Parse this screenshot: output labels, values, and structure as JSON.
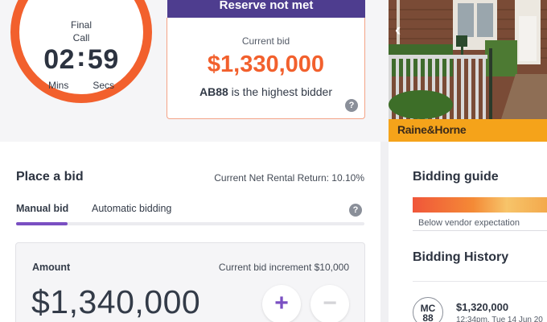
{
  "timer": {
    "label_line1": "Final",
    "label_line2": "Call",
    "minutes": "02",
    "separator": ":",
    "seconds": "59",
    "minutes_unit": "Mins",
    "seconds_unit": "Secs",
    "ring_color": "#f2602d"
  },
  "reserve": {
    "banner": "Reserve not met",
    "banner_color": "#4e3d8f"
  },
  "current_bid": {
    "label": "Current bid",
    "amount": "$1,330,000",
    "amount_color": "#f2602d",
    "bidder": "AB88",
    "bidder_suffix": " is the highest bidder",
    "help_icon": "?"
  },
  "property": {
    "agency": "Raine&Horne",
    "brand_color": "#f5a31a",
    "prev_icon": "‹"
  },
  "place_bid": {
    "title": "Place a bid",
    "rental_return": "Current Net Rental Return: 10.10%",
    "tabs": [
      {
        "label": "Manual bid",
        "active": true
      },
      {
        "label": "Automatic bidding",
        "active": false
      }
    ],
    "accent_color": "#7a4fc2",
    "help_icon": "?",
    "amount_label": "Amount",
    "increment": "Current bid increment $10,000",
    "amount_value": "$1,340,000",
    "plus": "+",
    "minus": "−"
  },
  "bidding_guide": {
    "title": "Bidding guide",
    "caption": "Below vendor expectation"
  },
  "bidding_history": {
    "title": "Bidding History",
    "entries": [
      {
        "avatar_line1": "MC",
        "avatar_line2": "88",
        "amount": "$1,320,000",
        "time": "12:34pm, Tue 14 Jun 20"
      }
    ]
  }
}
